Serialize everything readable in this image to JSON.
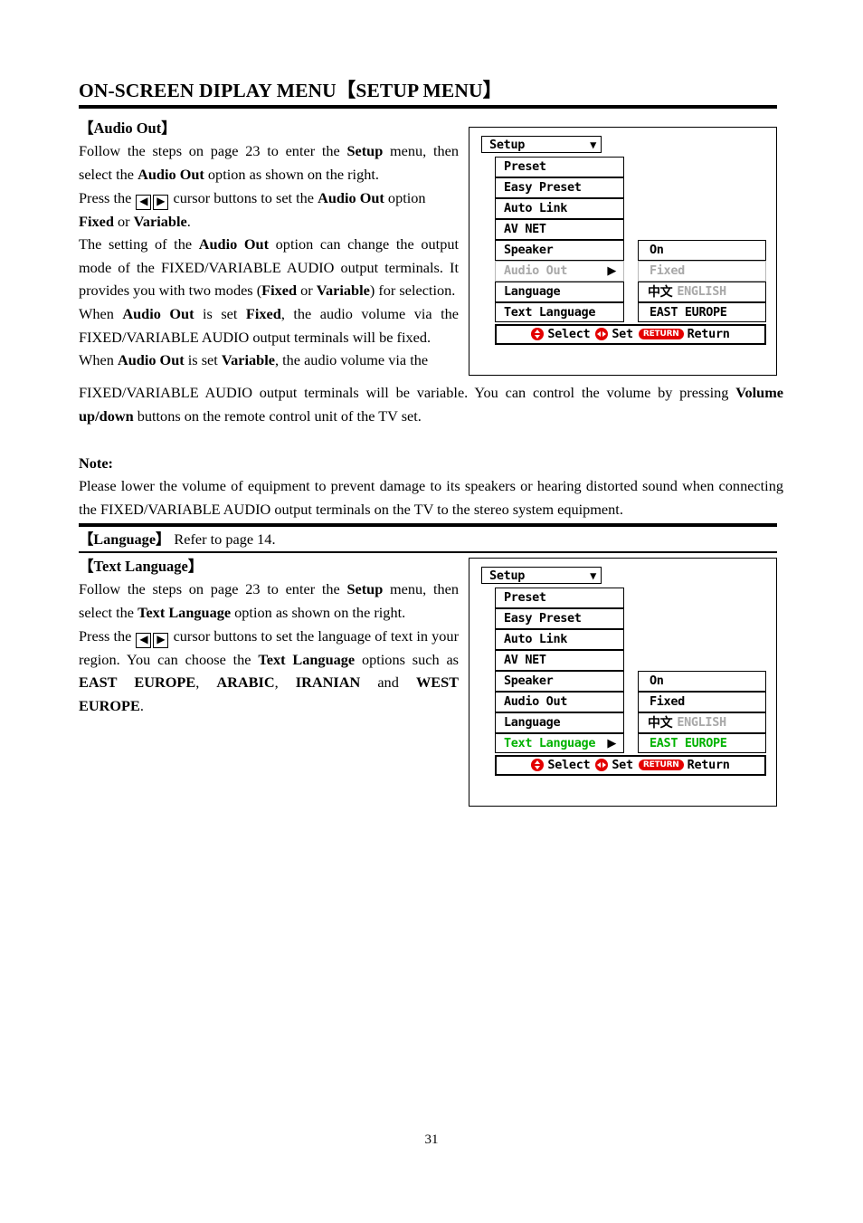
{
  "document": {
    "title": "ON-SCREEN DIPLAY MENU【SETUP MENU】",
    "page_number": "31"
  },
  "audio_out": {
    "heading": "【Audio Out】",
    "para1_a": "Follow the steps on page 23 to enter the ",
    "para1_b": "Setup",
    "para1_c": " menu, then select the ",
    "para1_d": "Audio Out",
    "para1_e": " option as shown on the right.",
    "para2_a": "Press the ",
    "para2_key_left": "◀",
    "para2_key_right": "▶",
    "para2_b": " cursor buttons to set the ",
    "para2_c": "Audio Out",
    "para2_d": " option ",
    "para2_e": "Fixed",
    "para2_f": " or ",
    "para2_g": "Variable",
    "para2_h": ".",
    "para3_a": "The setting of the ",
    "para3_b": "Audio Out",
    "para3_c": " option can change the output mode of the FIXED/VARIABLE AUDIO output terminals. It provides you with two modes (",
    "para3_d": "Fixed",
    "para3_e": " or ",
    "para3_f": "Variable",
    "para3_g": ") for selection.",
    "para4_a": "When ",
    "para4_b": "Audio Out",
    "para4_c": " is set ",
    "para4_d": "Fixed",
    "para4_e": ", the audio volume via the FIXED/VARIABLE AUDIO output terminals will be fixed.",
    "para5_a": "When ",
    "para5_b": "Audio Out",
    "para5_c": " is set ",
    "para5_d": "Variable",
    "para5_e": ", the audio volume via the",
    "para6_a": "FIXED/VARIABLE AUDIO output terminals will be variable. You can control the volume by pressing ",
    "para6_b": "Volume up/down",
    "para6_c": " buttons on the remote control unit of the TV set."
  },
  "note": {
    "label": "Note:",
    "text": "Please lower the volume of equipment to prevent damage to its speakers or hearing distorted sound when connecting the FIXED/VARIABLE AUDIO output terminals on the TV to the stereo system equipment."
  },
  "language_strip": {
    "bracket": "【Language】",
    "text": " Refer to page 14."
  },
  "text_language": {
    "heading": "【Text Language】",
    "para1_a": "Follow the steps on page 23 to enter the ",
    "para1_b": "Setup",
    "para1_c": " menu, then select the ",
    "para1_d": "Text Language",
    "para1_e": " option as shown on the right.",
    "para2_a": "Press the ",
    "para2_key_left": "◀",
    "para2_key_right": "▶",
    "para2_b": " cursor buttons to set the language of text in your region. You can choose the ",
    "para2_c": "Text Language",
    "para2_d": " options such as ",
    "para2_e": "EAST EUROPE",
    "para2_f": ", ",
    "para2_g": "ARABIC",
    "para2_h": ", ",
    "para2_i": "IRANIAN",
    "para2_j": " and ",
    "para2_k": "WEST EUROPE",
    "para2_l": "."
  },
  "osd_audio": {
    "header_label": "Setup",
    "header_caret": "▼",
    "rows": [
      {
        "label": "Preset",
        "value": "",
        "arrow": "",
        "state": "normal"
      },
      {
        "label": "Easy Preset",
        "value": "",
        "arrow": "",
        "state": "normal"
      },
      {
        "label": "Auto Link",
        "value": "",
        "arrow": "",
        "state": "normal"
      },
      {
        "label": "AV NET",
        "value": "",
        "arrow": "",
        "state": "normal"
      },
      {
        "label": "Speaker",
        "value": "On",
        "arrow": "",
        "state": "normal"
      },
      {
        "label": "Audio Out",
        "value": "Fixed",
        "arrow": "▶",
        "state": "dim"
      },
      {
        "label": "Language",
        "value_cjk": "中文",
        "value": "ENGLISH",
        "arrow": "",
        "state": "normal"
      },
      {
        "label": "Text Language",
        "value": "EAST EUROPE",
        "arrow": "",
        "state": "normal"
      }
    ],
    "bar": {
      "select_label": "Select",
      "set_label": "Set",
      "return_pill": "RETURN",
      "return_label": "Return"
    }
  },
  "osd_text": {
    "header_label": "Setup",
    "header_caret": "▼",
    "rows": [
      {
        "label": "Preset",
        "value": "",
        "arrow": "",
        "state": "normal"
      },
      {
        "label": "Easy Preset",
        "value": "",
        "arrow": "",
        "state": "normal"
      },
      {
        "label": "Auto Link",
        "value": "",
        "arrow": "",
        "state": "normal"
      },
      {
        "label": "AV NET",
        "value": "",
        "arrow": "",
        "state": "normal"
      },
      {
        "label": "Speaker",
        "value": "On",
        "arrow": "",
        "state": "normal"
      },
      {
        "label": "Audio Out",
        "value": "Fixed",
        "arrow": "",
        "state": "normal"
      },
      {
        "label": "Language",
        "value_cjk": "中文",
        "value": "ENGLISH",
        "arrow": "",
        "state": "normal"
      },
      {
        "label": "Text Language",
        "value": "EAST EUROPE",
        "arrow": "▶",
        "state": "green"
      }
    ],
    "bar": {
      "select_label": "Select",
      "set_label": "Set",
      "return_pill": "RETURN",
      "return_label": "Return"
    }
  },
  "colors": {
    "highlight_green": "#00b200",
    "dim_grey": "#a8a8a8",
    "icon_red": "#e40000"
  }
}
